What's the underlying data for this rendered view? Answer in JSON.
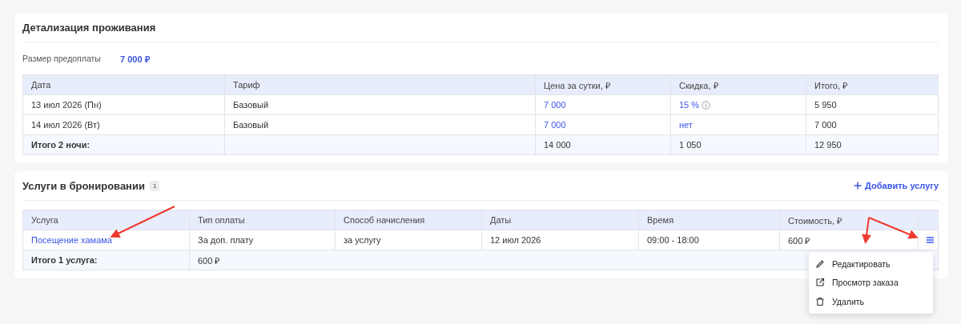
{
  "stay": {
    "title": "Детализация проживания",
    "prepayment": {
      "label": "Размер предоплаты",
      "value": "7 000 ₽"
    },
    "table": {
      "columns": [
        "Дата",
        "Тариф",
        "Цена за сутки, ₽",
        "Скидка, ₽",
        "Итого, ₽"
      ],
      "rows": [
        [
          {
            "text": "13 июл 2026 (Пн)",
            "link": false
          },
          {
            "text": "Базовый",
            "link": false
          },
          {
            "text": "7 000",
            "link": true
          },
          {
            "text": "15 %",
            "link": true,
            "info": true
          },
          {
            "text": "5 950",
            "link": false
          }
        ],
        [
          {
            "text": "14 июл 2026 (Вт)",
            "link": false
          },
          {
            "text": "Базовый",
            "link": false
          },
          {
            "text": "7 000",
            "link": true
          },
          {
            "text": "нет",
            "link": true
          },
          {
            "text": "7 000",
            "link": false
          }
        ]
      ],
      "total": {
        "label": "Итого 2 ночи:",
        "values": [
          "14 000",
          "1 050",
          "12 950"
        ]
      }
    }
  },
  "services": {
    "title": "Услуги в бронировании",
    "count": "1",
    "add_button": "Добавить услугу",
    "table": {
      "columns": [
        "Услуга",
        "Тип оплаты",
        "Способ начисления",
        "Даты",
        "Время",
        "Стоимость, ₽"
      ],
      "rows": [
        [
          {
            "text": "Посещение хамама",
            "link": true
          },
          {
            "text": "За доп. плату",
            "link": false
          },
          {
            "text": "за услугу",
            "link": false
          },
          {
            "text": "12 июл 2026",
            "link": false
          },
          {
            "text": "09:00 - 18:00",
            "link": false
          },
          {
            "text": "600 ₽",
            "link": false
          }
        ]
      ],
      "total": [
        "Итого 1 услуга:",
        "600 ₽"
      ]
    },
    "menu": {
      "items": [
        {
          "label": "Редактировать"
        },
        {
          "label": "Просмотр заказа"
        },
        {
          "label": "Удалить"
        }
      ]
    }
  }
}
